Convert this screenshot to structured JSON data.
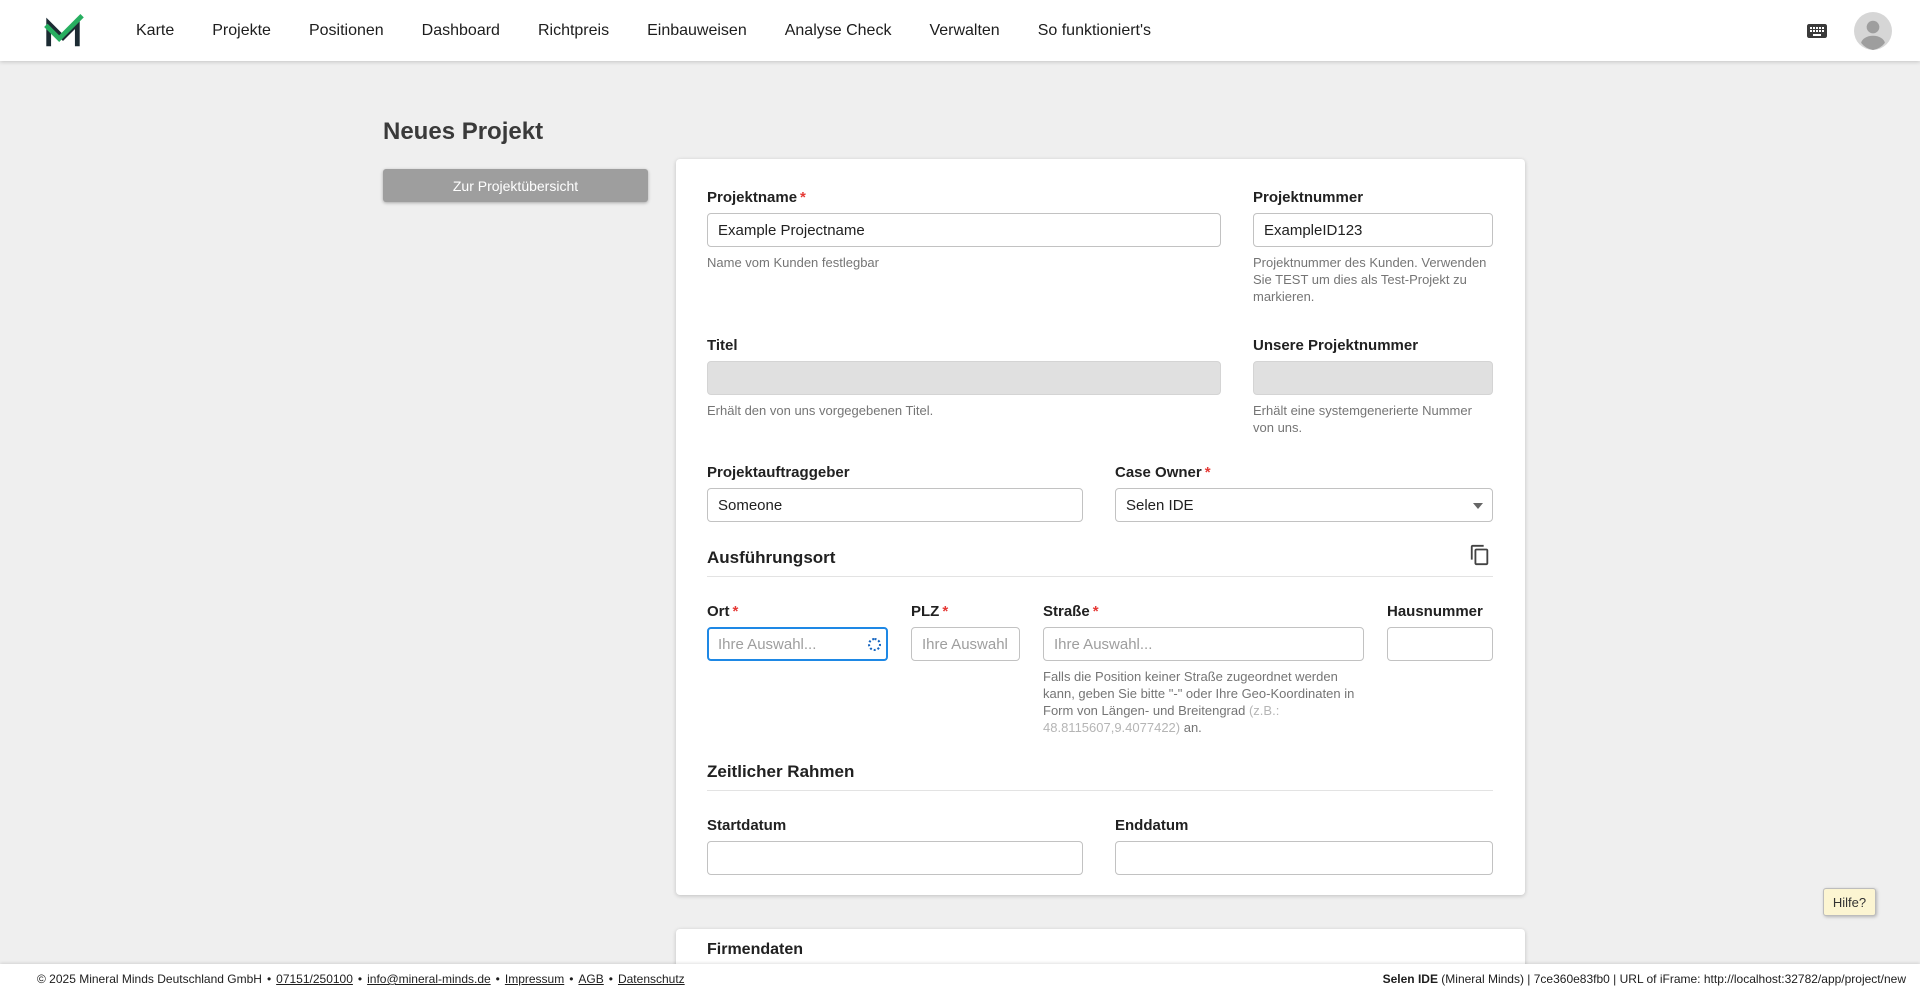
{
  "nav": {
    "items": [
      "Karte",
      "Projekte",
      "Positionen",
      "Dashboard",
      "Richtpreis",
      "Einbauweisen",
      "Analyse Check",
      "Verwalten",
      "So funktioniert's"
    ]
  },
  "page": {
    "title": "Neues Projekt",
    "back_button_label": "Zur Projektübersicht",
    "help_label": "Hilfe?",
    "required_marker": "*"
  },
  "form": {
    "projektname": {
      "label": "Projektname",
      "value": "Example Projectname",
      "helper": "Name vom Kunden festlegbar"
    },
    "projektnummer": {
      "label": "Projektnummer",
      "value": "ExampleID123",
      "helper": "Projektnummer des Kunden. Verwenden Sie TEST um dies als Test-Projekt zu markieren."
    },
    "titel": {
      "label": "Titel",
      "helper": "Erhält den von uns vorgegebenen Titel."
    },
    "unsere_projektnummer": {
      "label": "Unsere Projektnummer",
      "helper": "Erhält eine systemgenerierte Nummer von uns."
    },
    "projektauftraggeber": {
      "label": "Projektauftraggeber",
      "value": "Someone"
    },
    "case_owner": {
      "label": "Case Owner",
      "value": "Selen IDE"
    },
    "sections": {
      "ausfuehrungsort": "Ausführungsort",
      "zeitlicher_rahmen": "Zeitlicher Rahmen",
      "firmendaten": "Firmendaten"
    },
    "ort": {
      "label": "Ort",
      "placeholder": "Ihre Auswahl..."
    },
    "plz": {
      "label": "PLZ",
      "placeholder": "Ihre Auswahl."
    },
    "strasse": {
      "label": "Straße",
      "placeholder": "Ihre Auswahl...",
      "helper_main": "Falls die Position keiner Straße zugeordnet werden kann, geben Sie bitte \"-\" oder Ihre Geo-Koordinaten in Form von Längen- und Breitengrad ",
      "helper_example": "(z.B.: 48.8115607,9.4077422)",
      "helper_suffix": " an."
    },
    "hausnummer": {
      "label": "Hausnummer"
    },
    "startdatum": {
      "label": "Startdatum"
    },
    "enddatum": {
      "label": "Enddatum"
    }
  },
  "footer": {
    "copyright": "© 2025 Mineral Minds Deutschland GmbH",
    "bullet": "•",
    "links": {
      "phone": "07151/250100",
      "email": "info@mineral-minds.de",
      "impressum": "Impressum",
      "agb": "AGB",
      "datenschutz": "Datenschutz"
    },
    "session_user": "Selen IDE",
    "session_rest": " (Mineral Minds) | 7ce360e83fb0 | URL of iFrame: http://localhost:32782/app/project/new"
  },
  "colors": {
    "accent_green": "#27ae60",
    "focus_blue": "#1e88e5",
    "required_red": "#e53935",
    "help_yellow": "#fcf5d2"
  }
}
